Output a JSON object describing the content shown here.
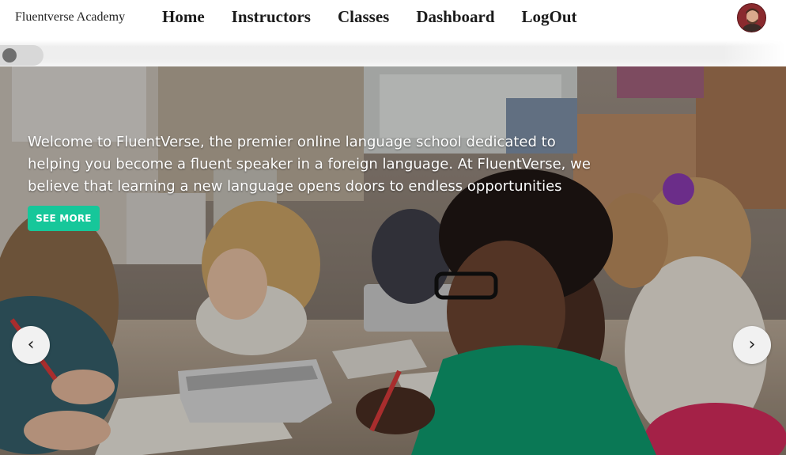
{
  "navbar": {
    "brand": "Fluentverse Academy",
    "links": [
      {
        "label": "Home"
      },
      {
        "label": "Instructors"
      },
      {
        "label": "Classes"
      },
      {
        "label": "Dashboard"
      },
      {
        "label": "LogOut"
      }
    ],
    "avatar_icon": "user-avatar"
  },
  "theme_toggle": {
    "state": "off",
    "icon": "toggle-switch"
  },
  "hero": {
    "text": "Welcome to FluentVerse, the premier online language school dedicated to helping you become a fluent speaker in a foreign language. At FluentVerse, we believe that learning a new language opens doors to endless opportunities",
    "button_label": "SEE MORE",
    "prev_arrow": "‹",
    "next_arrow": "›",
    "image_description_icon": "classroom-photo"
  },
  "colors": {
    "accent": "#16c79a",
    "nav_text": "#1a1a1a",
    "hero_text": "#ffffff",
    "arrow_bg": "#f1f1f1"
  }
}
